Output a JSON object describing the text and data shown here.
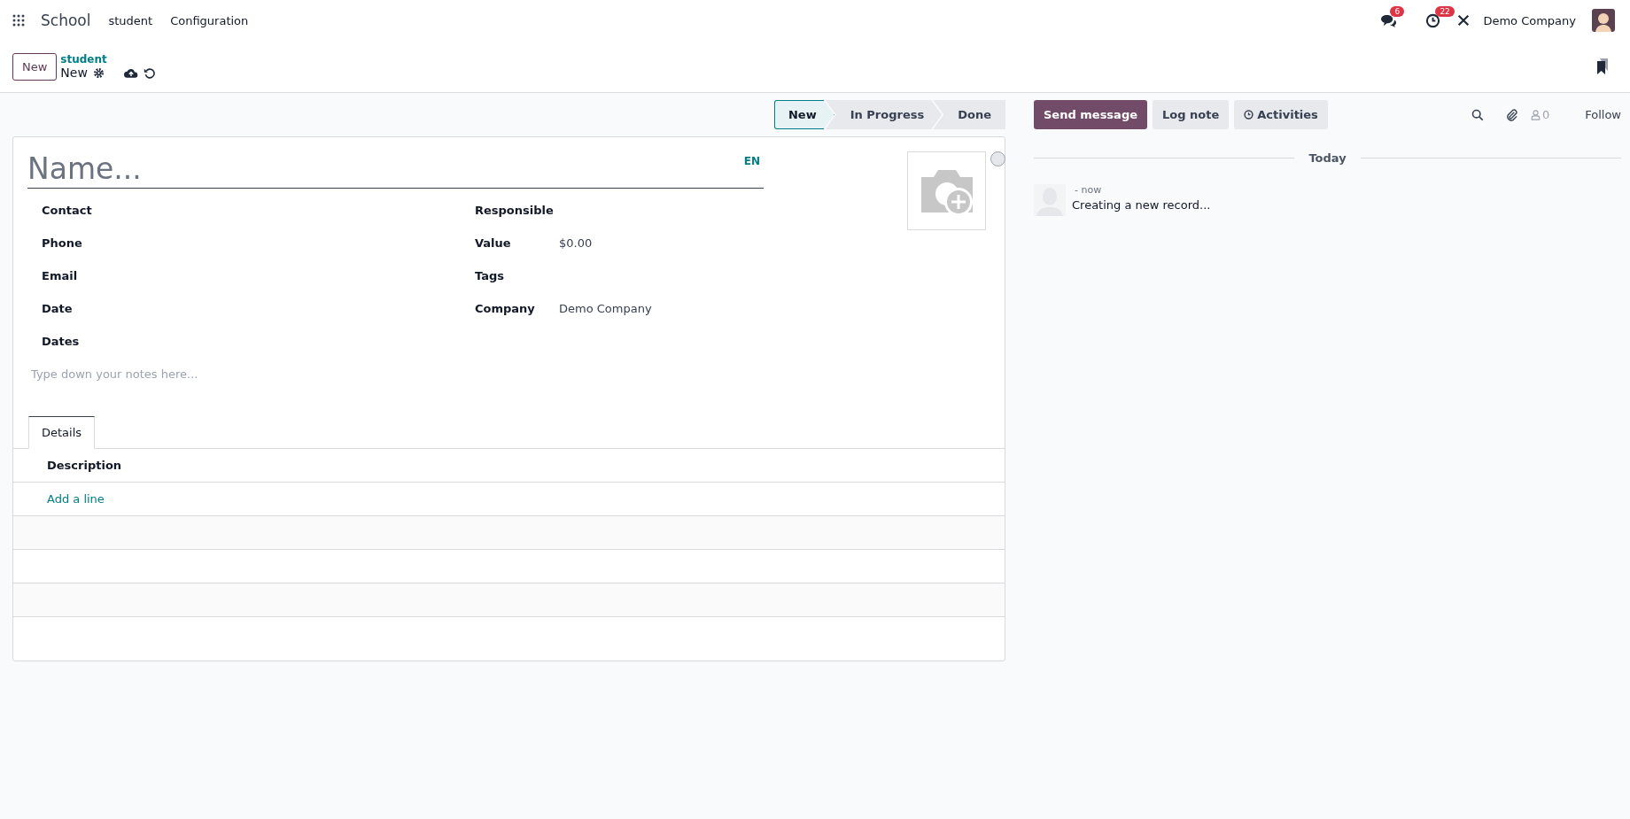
{
  "top_nav": {
    "app": "School",
    "menu": [
      {
        "label": "student"
      },
      {
        "label": "Configuration"
      }
    ],
    "messages_badge": "6",
    "activities_badge": "22",
    "company": "Demo Company"
  },
  "control_panel": {
    "new_button": "New",
    "breadcrumb": "student",
    "record": "New"
  },
  "statusbar": [
    {
      "label": "New",
      "selected": true
    },
    {
      "label": "In Progress",
      "selected": false
    },
    {
      "label": "Done",
      "selected": false
    }
  ],
  "form": {
    "name_placeholder": "Name...",
    "language": "EN",
    "left_fields": [
      {
        "label": "Contact"
      },
      {
        "label": "Phone"
      },
      {
        "label": "Email"
      },
      {
        "label": "Date"
      },
      {
        "label": "Dates"
      }
    ],
    "right_fields": [
      {
        "label": "Responsible"
      },
      {
        "label": "Value",
        "value": "$0.00"
      },
      {
        "label": "Tags"
      },
      {
        "label": "Company",
        "value": "Demo Company"
      }
    ],
    "notes_placeholder": "Type down your notes here...",
    "tabs": [
      {
        "label": "Details",
        "selected": true
      }
    ],
    "table": {
      "columns": [
        "Description"
      ],
      "add_line": "Add a line"
    }
  },
  "chatter": {
    "buttons": [
      {
        "label": "Send message",
        "kind": "primary"
      },
      {
        "label": "Log note",
        "kind": "secondary"
      },
      {
        "label": "Activities",
        "kind": "activity"
      }
    ],
    "follower_count": "0",
    "follow": "Follow",
    "date_separator": "Today",
    "messages": [
      {
        "time": "- now",
        "body": "Creating a new record..."
      }
    ]
  }
}
